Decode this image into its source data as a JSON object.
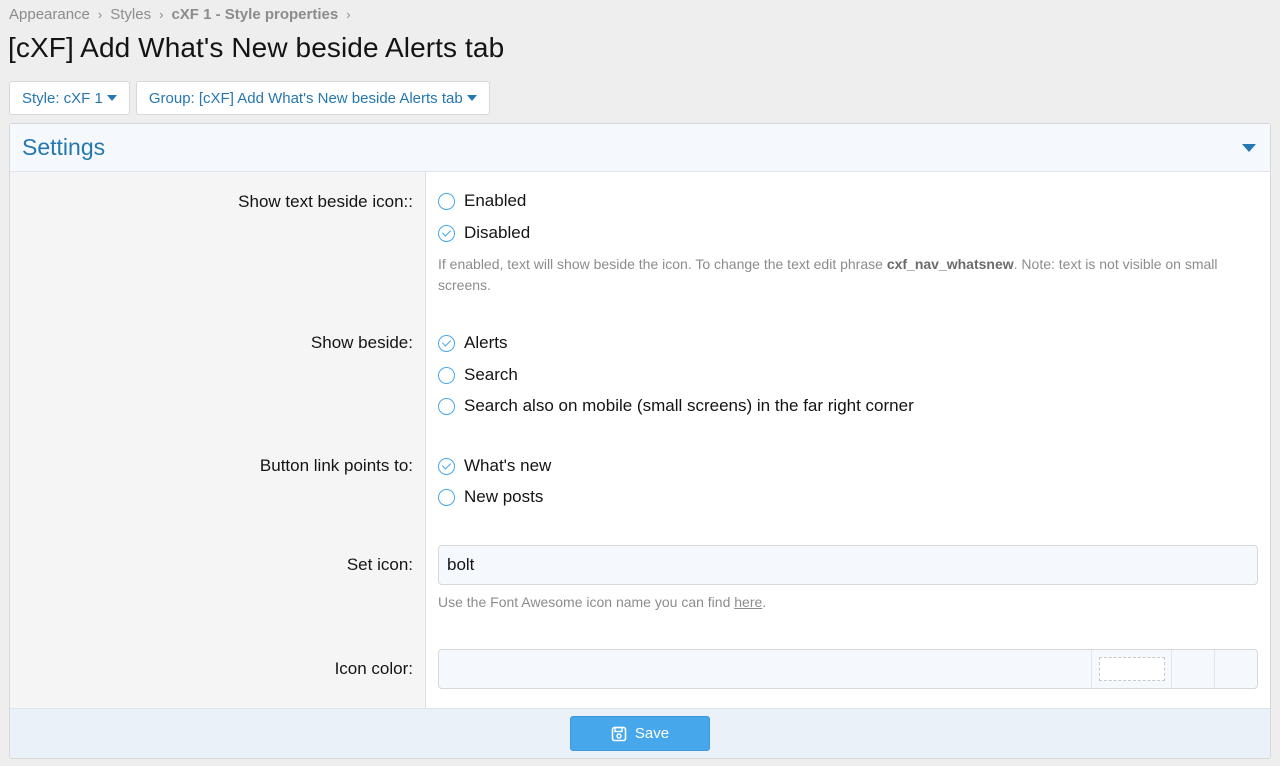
{
  "breadcrumb": [
    "Appearance",
    "Styles",
    "cXF 1 - Style properties"
  ],
  "title": "[cXF] Add What's New beside Alerts tab",
  "filters": {
    "style": "Style: cXF 1",
    "group": "Group: [cXF] Add What's New beside Alerts tab"
  },
  "section": {
    "title": "Settings"
  },
  "fields": {
    "show_text": {
      "label": "Show text beside icon::",
      "options": [
        {
          "label": "Enabled",
          "checked": false
        },
        {
          "label": "Disabled",
          "checked": true
        }
      ],
      "hint_pre": "If enabled, text will show beside the icon. To change the text edit phrase ",
      "hint_bold": "cxf_nav_whatsnew",
      "hint_post": ". Note: text is not visible on small screens."
    },
    "show_beside": {
      "label": "Show beside:",
      "options": [
        {
          "label": "Alerts",
          "checked": true
        },
        {
          "label": "Search",
          "checked": false
        },
        {
          "label": "Search also on mobile (small screens) in the far right corner",
          "checked": false
        }
      ]
    },
    "link_points": {
      "label": "Button link points to:",
      "options": [
        {
          "label": "What's new",
          "checked": true
        },
        {
          "label": "New posts",
          "checked": false
        }
      ]
    },
    "set_icon": {
      "label": "Set icon:",
      "value": "bolt",
      "hint_pre": "Use the Font Awesome icon name you can find ",
      "hint_link": "here",
      "hint_post": "."
    },
    "icon_color": {
      "label": "Icon color:",
      "value": ""
    }
  },
  "footer": {
    "save_label": "Save"
  },
  "colors": {
    "accent": "#2577b1",
    "button": "#47a7eb",
    "hint": "#8c8c8c"
  }
}
